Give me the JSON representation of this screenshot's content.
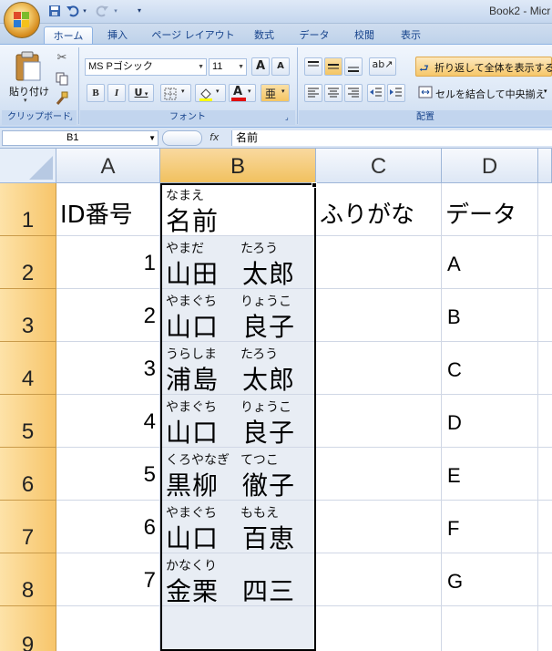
{
  "window": {
    "title": "Book2 - Micr"
  },
  "tabs": [
    {
      "label": "ホーム"
    },
    {
      "label": "挿入"
    },
    {
      "label": "ページ レイアウト"
    },
    {
      "label": "数式"
    },
    {
      "label": "データ"
    },
    {
      "label": "校閲"
    },
    {
      "label": "表示"
    }
  ],
  "ribbon": {
    "clipboard": {
      "paste_label": "貼り付け",
      "group_label": "クリップボード"
    },
    "font": {
      "font_name": "MS Pゴシック",
      "font_size": "11",
      "bold": "B",
      "italic": "I",
      "underline": "U",
      "grow": "A",
      "shrink": "A",
      "color_a": "A",
      "phonetic": "亜",
      "group_label": "フォント"
    },
    "alignment": {
      "wrap_label": "折り返して全体を表示する",
      "merge_label": "セルを結合して中央揃え",
      "group_label": "配置"
    }
  },
  "formula_bar": {
    "name_box": "B1",
    "fx": "fx",
    "content": "名前"
  },
  "columns": [
    "A",
    "B",
    "C",
    "D"
  ],
  "rows": [
    "1",
    "2",
    "3",
    "4",
    "5",
    "6",
    "7",
    "8",
    "9"
  ],
  "header_row": {
    "a": "ID番号",
    "b_ruby": "なまえ",
    "b": "名前",
    "c": "ふりがな",
    "d": "データ"
  },
  "records": [
    {
      "id": "1",
      "ruby1": "やまだ",
      "name1": "山田",
      "ruby2": "たろう",
      "name2": "太郎",
      "data": "A"
    },
    {
      "id": "2",
      "ruby1": "やまぐち",
      "name1": "山口",
      "ruby2": "りょうこ",
      "name2": "良子",
      "data": "B"
    },
    {
      "id": "3",
      "ruby1": "うらしま",
      "name1": "浦島",
      "ruby2": "たろう",
      "name2": "太郎",
      "data": "C"
    },
    {
      "id": "4",
      "ruby1": "やまぐち",
      "name1": "山口",
      "ruby2": "りょうこ",
      "name2": "良子",
      "data": "D"
    },
    {
      "id": "5",
      "ruby1": "くろやなぎ",
      "name1": "黒柳",
      "ruby2": "てつこ",
      "name2": "徹子",
      "data": "E"
    },
    {
      "id": "6",
      "ruby1": "やまぐち",
      "name1": "山口",
      "ruby2": "ももえ",
      "name2": "百恵",
      "data": "F"
    },
    {
      "id": "7",
      "ruby1": "かなくり",
      "name1": "金栗",
      "ruby2": "",
      "name2": "四三",
      "data": "G"
    }
  ],
  "icons": {
    "office_button": "office-logo-icon",
    "save": "save-icon",
    "undo": "undo-icon",
    "redo": "redo-icon",
    "cut": "scissors-icon",
    "copy": "copy-icon",
    "format_painter": "brush-icon"
  },
  "colors": {
    "selected_col_header": "#f1c15f",
    "row_header": "#f7c56a",
    "ribbon_text": "#15428b"
  }
}
